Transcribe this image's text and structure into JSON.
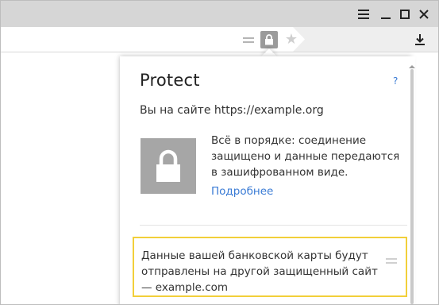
{
  "window": {
    "controls": [
      {
        "name": "menu",
        "icon": "hamburger-menu-icon"
      },
      {
        "name": "minimize",
        "icon": "minimize-icon"
      },
      {
        "name": "maximize",
        "icon": "maximize-icon"
      },
      {
        "name": "close",
        "icon": "close-icon"
      }
    ]
  },
  "toolbar": {
    "reader_icon": "reader-mode-icon",
    "lock_icon": "lock-icon",
    "bookmark_icon": "star-icon",
    "download_icon": "download-icon"
  },
  "popup": {
    "title": "Protect",
    "help": "?",
    "site_line": "Вы на сайте https://example.org",
    "status": "Всё в порядке: соединение защищено и данные передаются в зашифрованном виде.",
    "more_link": "Подробнее",
    "warning": "Данные вашей банковской карты будут отправлены на другой защищенный сайт — example.com"
  },
  "colors": {
    "titlebar": "#d6d6d6",
    "link": "#3a7bd5",
    "lock_tile": "#a6a6a6",
    "warning_border": "#f2cf3a"
  }
}
